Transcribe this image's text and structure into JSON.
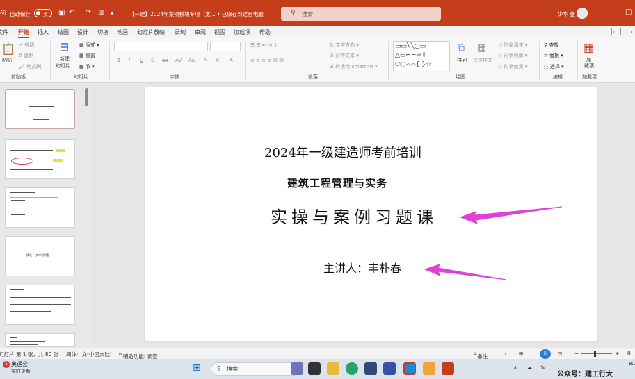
{
  "titlebar": {
    "autosave_label": "自动保存",
    "toggle_state": "关",
    "doc_title": "【一建】2024年案例模块专项（太...",
    "save_status": "• 已保存到这台电脑",
    "search_placeholder": "搜索",
    "user_name": "少华 张"
  },
  "menu": {
    "items": [
      "文件",
      "开始",
      "插入",
      "绘图",
      "设计",
      "切换",
      "动画",
      "幻灯片放映",
      "录制",
      "审阅",
      "视图",
      "加载项",
      "帮助"
    ],
    "active": "开始"
  },
  "ribbon": {
    "clipboard": {
      "paste": "粘贴",
      "cut": "剪切",
      "copy": "复制",
      "format_painter": "格式刷",
      "label": "剪贴板"
    },
    "slides": {
      "new_slide": "新建",
      "new_slide2": "幻灯片",
      "layout": "版式",
      "reset": "重置",
      "section": "节",
      "label": "幻灯片"
    },
    "font": {
      "label": "字体"
    },
    "paragraph": {
      "text_direction": "文字方向",
      "align_text": "对齐文本",
      "smartart": "转换为 SmartArt",
      "label": "段落"
    },
    "drawing": {
      "arrange": "排列",
      "quick_styles": "快速样式",
      "shape_fill": "形状填充",
      "shape_outline": "形状轮廓",
      "shape_effects": "形状效果",
      "label": "绘图"
    },
    "editing": {
      "find": "查找",
      "replace": "替换",
      "select": "选择",
      "label": "编辑"
    },
    "addins": {
      "addin1": "加",
      "addin2": "载项",
      "label": "加载项"
    }
  },
  "slide": {
    "line1": "2024年一级建造师考前培训",
    "line2": "建筑工程管理与实务",
    "line3": "实操与案例习题课",
    "line4": "主讲人：丰朴春"
  },
  "thumbnails": {
    "thumb4_text": "模块一  文字说明题"
  },
  "statusbar": {
    "slide_count": "幻灯片 第 1 张，共 80 张",
    "language": "简体中文(中国大陆)",
    "accessibility": "辅助功能: 调查",
    "notes": "备注"
  },
  "taskbar": {
    "notification_title": "奥运会",
    "notification_sub": "实时更新",
    "search_label": "搜索",
    "badge": "1",
    "time": "8:2"
  },
  "watermark": "公众号：建工行大",
  "colors": {
    "accent": "#c43e1c",
    "arrow": "#e040d8"
  }
}
